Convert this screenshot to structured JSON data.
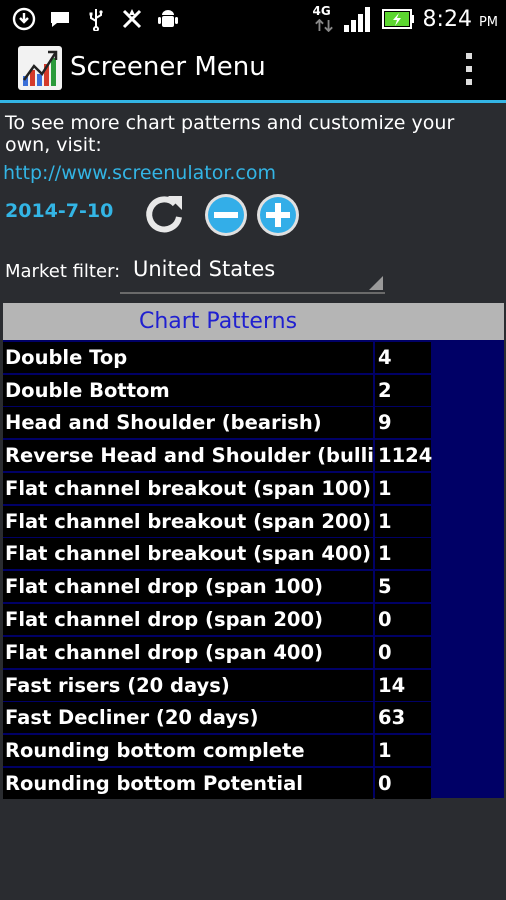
{
  "status_bar": {
    "network": "4G",
    "time": "8:24",
    "ampm": "PM",
    "icons": [
      "download-icon",
      "chat-icon",
      "usb-icon",
      "no-signal-icon",
      "android-debug-icon",
      "data-arrows-icon",
      "signal-icon",
      "battery-charging-icon"
    ]
  },
  "action_bar": {
    "title": "Screener Menu",
    "accent": "#33b5e5"
  },
  "intro_text": "To see more chart patterns and customize your own, visit:",
  "link": "http://www.screenulator.com",
  "date": "2014-7-10",
  "buttons": [
    "refresh-icon",
    "zoom-out-icon",
    "zoom-in-icon"
  ],
  "market_filter": {
    "label": "Market filter:",
    "value": "United States"
  },
  "table": {
    "header": "Chart Patterns",
    "rows": [
      {
        "name": "Double Top",
        "count": "4"
      },
      {
        "name": "Double Bottom",
        "count": "2"
      },
      {
        "name": "Head and Shoulder (bearish)",
        "count": "9"
      },
      {
        "name": "Reverse Head and Shoulder (bullish)",
        "count": "1124"
      },
      {
        "name": "Flat channel breakout (span 100)",
        "count": "1"
      },
      {
        "name": "Flat channel breakout (span 200)",
        "count": "1"
      },
      {
        "name": "Flat channel breakout (span 400)",
        "count": "1"
      },
      {
        "name": "Flat channel drop (span 100)",
        "count": "5"
      },
      {
        "name": "Flat channel drop (span 200)",
        "count": "0"
      },
      {
        "name": "Flat channel drop (span 400)",
        "count": "0"
      },
      {
        "name": "Fast risers (20 days)",
        "count": "14"
      },
      {
        "name": "Fast Decliner (20 days)",
        "count": "63"
      },
      {
        "name": "Rounding bottom complete",
        "count": "1"
      },
      {
        "name": "Rounding bottom Potential",
        "count": "0"
      }
    ]
  }
}
